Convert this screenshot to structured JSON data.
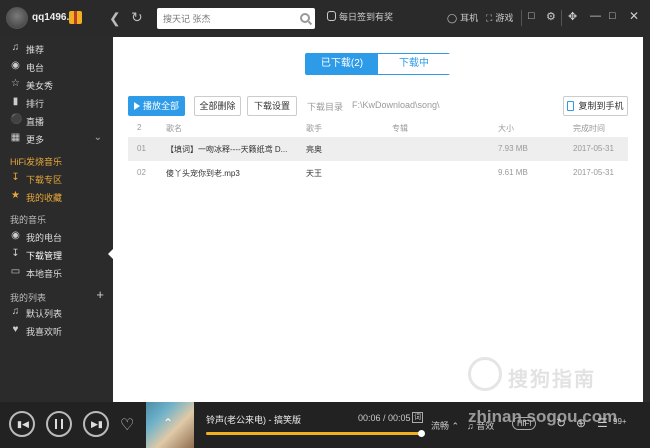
{
  "header": {
    "username": "qq1496...",
    "search_placeholder": "搜天记 张杰",
    "signin_label": "每日签到有奖",
    "headset_label": "耳机",
    "game_label": "游戏"
  },
  "sidebar": {
    "top_items": [
      {
        "label": "推荐",
        "icon": "music-note-icon"
      },
      {
        "label": "电台",
        "icon": "radio-icon"
      },
      {
        "label": "美女秀",
        "icon": "star-icon"
      },
      {
        "label": "排行",
        "icon": "chart-icon"
      },
      {
        "label": "直播",
        "icon": "mic-icon"
      },
      {
        "label": "更多",
        "icon": "grid-icon"
      }
    ],
    "hifi_title": "HiFi发烧音乐",
    "hifi_items": [
      {
        "label": "下载专区",
        "icon": "download-icon"
      },
      {
        "label": "我的收藏",
        "icon": "star-icon"
      }
    ],
    "my_music_title": "我的音乐",
    "my_music_items": [
      {
        "label": "我的电台",
        "icon": "radio-icon"
      },
      {
        "label": "下载管理",
        "icon": "download-icon"
      },
      {
        "label": "本地音乐",
        "icon": "monitor-icon"
      }
    ],
    "my_lists_title": "我的列表",
    "my_lists_items": [
      {
        "label": "默认列表",
        "icon": "music-note-icon"
      },
      {
        "label": "我喜欢听",
        "icon": "heart-icon"
      }
    ]
  },
  "main": {
    "tabs": [
      {
        "label": "已下载(2)",
        "active": true
      },
      {
        "label": "下载中",
        "active": false
      }
    ],
    "toolbar": {
      "play_all": "播放全部",
      "delete_all": "全部删除",
      "download_settings": "下载设置",
      "dir_label": "下载目录",
      "dir_path": "F:\\KwDownload\\song\\",
      "copy_to_phone": "复制到手机"
    },
    "columns": {
      "index": "2",
      "name": "歌名",
      "artist": "歌手",
      "album": "专辑",
      "size": "大小",
      "completed": "完成时间"
    },
    "rows": [
      {
        "index": "01",
        "name": "【填词】一吻冰释----天籁纸鸢 D...",
        "artist": "亮奥",
        "album": "",
        "size": "7.93 MB",
        "completed": "2017-05-31"
      },
      {
        "index": "02",
        "name": "傻丫头宠你到老.mp3",
        "artist": "天王",
        "album": "",
        "size": "9.61 MB",
        "completed": "2017-05-31"
      }
    ],
    "watermark": "搜狗指南"
  },
  "player": {
    "song_title": "铃声(老公来电) - 搞笑版",
    "time": "00:06 / 00:05",
    "lyric_btn": "词",
    "progress": 1.0,
    "mode_label": "流畅",
    "effect_label": "音效",
    "hifi_label": "HiFi",
    "count_label": "99+",
    "watermark": "zhinan.sogou.com"
  }
}
